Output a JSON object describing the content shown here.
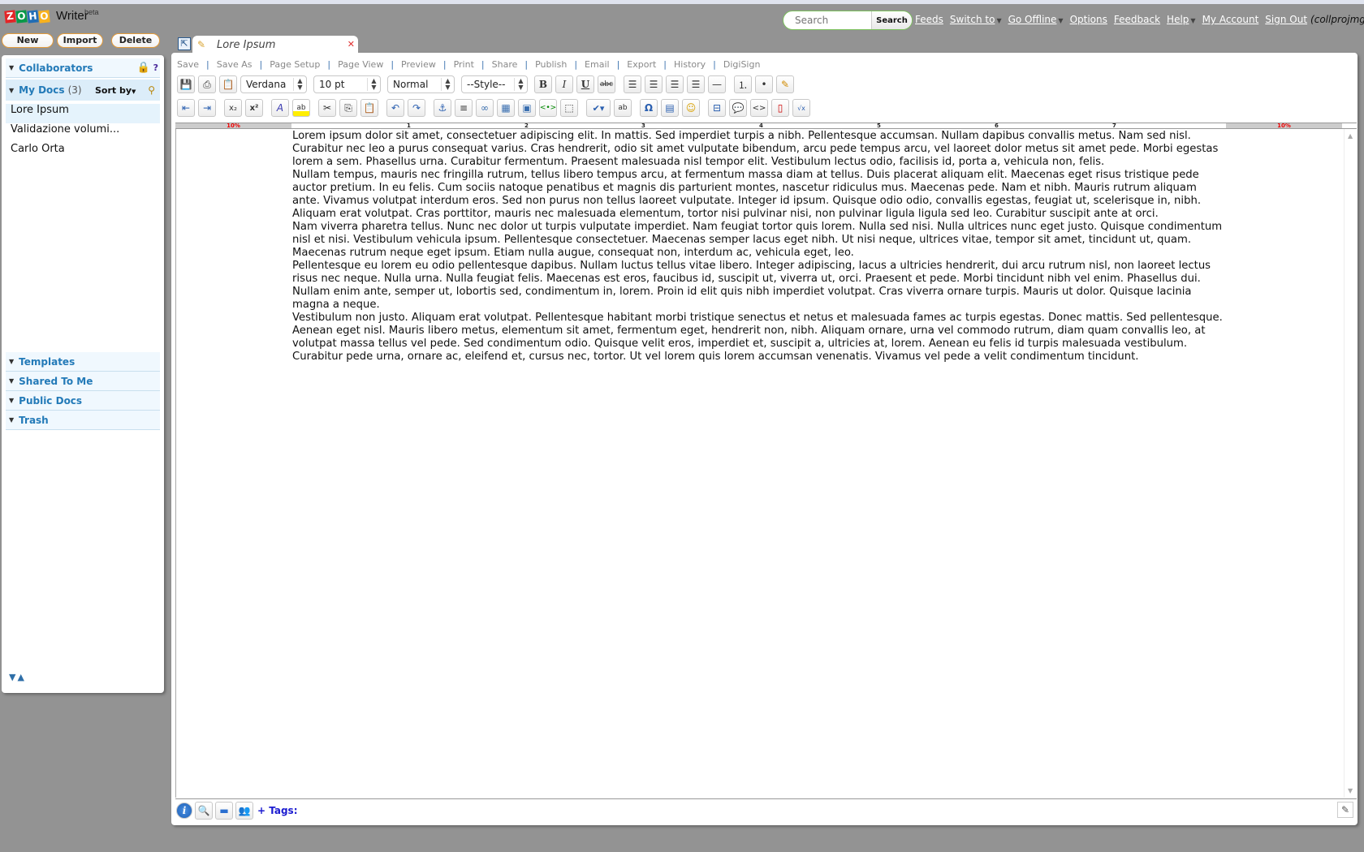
{
  "app": {
    "logo_text": "ZOHO",
    "logo_letters": [
      "Z",
      "O",
      "H",
      "O"
    ],
    "product": "Writer",
    "badge": "beta"
  },
  "top_buttons": {
    "new": "New",
    "import": "Import",
    "delete": "Delete"
  },
  "search": {
    "placeholder": "Search",
    "button": "Search"
  },
  "topnav": {
    "feeds": "Feeds",
    "switch_to": "Switch to",
    "go_offline": "Go Offline",
    "options": "Options",
    "feedback": "Feedback",
    "help": "Help",
    "my_account": "My Account",
    "sign_out": "Sign Out",
    "user": "(collprojmgmt)"
  },
  "sidebar": {
    "collaborators": "Collaborators",
    "help_mark": "?",
    "my_docs": "My Docs",
    "my_docs_count": "(3)",
    "sort_by": "Sort by",
    "docs": [
      {
        "name": "Lore Ipsum",
        "active": true
      },
      {
        "name": "Validazione volumi...",
        "active": false
      },
      {
        "name": "Carlo Orta",
        "active": false
      }
    ],
    "sections": [
      "Templates",
      "Shared To Me",
      "Public Docs",
      "Trash"
    ]
  },
  "editor": {
    "tab_title": "Lore Ipsum",
    "menu": [
      "Save",
      "Save As",
      "Page Setup",
      "Page View",
      "Preview",
      "Print",
      "Share",
      "Publish",
      "Email",
      "Export",
      "History",
      "DigiSign"
    ],
    "font_family": "Verdana",
    "font_size": "10 pt",
    "paragraph": "Normal",
    "style": "--Style--",
    "toolbar_row1": [
      "save-icon",
      "print-icon",
      "paste-special-icon",
      "bold-icon",
      "italic-icon",
      "underline-icon",
      "strikethrough-icon",
      "align-left-icon",
      "align-center-icon",
      "align-right-icon",
      "justify-icon",
      "horizontal-rule-icon",
      "numbered-list-icon",
      "bulleted-list-icon",
      "edit-form-icon"
    ],
    "toolbar_row2": [
      "outdent-icon",
      "indent-icon",
      "subscript-icon",
      "superscript-icon",
      "font-color-icon",
      "highlight-icon",
      "cut-icon",
      "copy-icon",
      "paste-icon",
      "undo-icon",
      "redo-icon",
      "anchor-icon",
      "line-spacing-icon",
      "link-icon",
      "table-icon",
      "image-icon",
      "embed-icon",
      "select-all-icon",
      "spellcheck-icon",
      "find-replace-icon",
      "special-char-icon",
      "toc-icon",
      "smiley-icon",
      "page-break-icon",
      "comment-icon",
      "html-source-icon",
      "pdf-icon",
      "equation-icon"
    ],
    "ruler": {
      "left_margin": "10%",
      "right_margin": "10%",
      "ticks": [
        "1",
        "2",
        "3",
        "4",
        "5",
        "6",
        "7"
      ]
    },
    "paragraphs": [
      "Lorem ipsum dolor sit amet, consectetuer adipiscing elit. In mattis. Sed imperdiet turpis a nibh. Pellentesque accumsan. Nullam dapibus convallis metus. Nam sed nisl. Curabitur nec leo a purus consequat varius. Cras hendrerit, odio sit amet vulputate bibendum, arcu pede tempus arcu, vel laoreet dolor metus sit amet pede. Morbi egestas lorem a sem. Phasellus urna. Curabitur fermentum. Praesent malesuada nisl tempor elit. Vestibulum lectus odio, facilisis id, porta a, vehicula non, felis.",
      "Nullam tempus, mauris nec fringilla rutrum, tellus libero tempus arcu, at fermentum massa diam at tellus. Duis placerat aliquam elit. Maecenas eget risus tristique pede auctor pretium. In eu felis. Cum sociis natoque penatibus et magnis dis parturient montes, nascetur ridiculus mus. Maecenas pede. Nam et nibh. Mauris rutrum aliquam ante. Vivamus volutpat interdum eros. Sed non purus non tellus laoreet vulputate. Integer id ipsum. Quisque odio odio, convallis egestas, feugiat ut, scelerisque in, nibh. Aliquam erat volutpat. Cras porttitor, mauris nec malesuada elementum, tortor nisi pulvinar nisi, non pulvinar ligula ligula sed leo. Curabitur suscipit ante at orci.",
      "Nam viverra pharetra tellus. Nunc nec dolor ut turpis vulputate imperdiet. Nam feugiat tortor quis lorem. Nulla sed nisi. Nulla ultrices nunc eget justo. Quisque condimentum nisl et nisi. Vestibulum vehicula ipsum. Pellentesque consectetuer. Maecenas semper lacus eget nibh. Ut nisi neque, ultrices vitae, tempor sit amet, tincidunt ut, quam. Maecenas rutrum neque eget ipsum. Etiam nulla augue, consequat non, interdum ac, vehicula eget, leo.",
      "Pellentesque eu lorem eu odio pellentesque dapibus. Nullam luctus tellus vitae libero. Integer adipiscing, lacus a ultricies hendrerit, dui arcu rutrum nisl, non laoreet lectus risus nec neque. Nulla urna. Nulla feugiat felis. Maecenas est eros, faucibus id, suscipit ut, viverra ut, orci. Praesent et pede. Morbi tincidunt nibh vel enim. Phasellus dui. Nullam enim ante, semper ut, lobortis sed, condimentum in, lorem. Proin id elit quis nibh imperdiet volutpat. Cras viverra ornare turpis. Mauris ut dolor. Quisque lacinia magna a neque.",
      "Vestibulum non justo. Aliquam erat volutpat. Pellentesque habitant morbi tristique senectus et netus et malesuada fames ac turpis egestas. Donec mattis. Sed pellentesque. Aenean eget nisl. Mauris libero metus, elementum sit amet, fermentum eget, hendrerit non, nibh. Aliquam ornare, urna vel commodo rutrum, diam quam convallis leo, at volutpat massa tellus vel pede. Sed condimentum odio. Quisque velit eros, imperdiet et, suscipit a, ultricies at, lorem. Aenean eu felis id turpis malesuada vestibulum. Curabitur pede urna, ornare ac, eleifend et, cursus nec, tortor. Ut vel lorem quis lorem accumsan venenatis. Vivamus vel pede a velit condimentum tincidunt."
    ],
    "bottom": {
      "tags_label": "+ Tags:"
    }
  }
}
